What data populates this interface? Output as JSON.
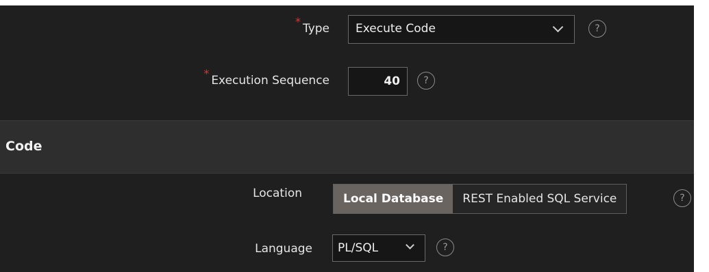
{
  "fields": {
    "type": {
      "label": "Type",
      "required_mark": "*",
      "value": "Execute Code",
      "help": "?"
    },
    "execution_sequence": {
      "label": "Execution Sequence",
      "required_mark": "*",
      "value": "40",
      "help": "?"
    }
  },
  "section": {
    "title": "Code"
  },
  "code": {
    "location": {
      "label": "Location",
      "options": [
        "Local Database",
        "REST Enabled SQL Service"
      ],
      "selected": "Local Database",
      "help": "?"
    },
    "language": {
      "label": "Language",
      "value": "PL/SQL",
      "help": "?"
    }
  },
  "colors": {
    "panel_bg": "#1f1f1f",
    "section_bg": "#2e2e2e",
    "required": "#d9392f",
    "active_segment": "#6a6461"
  }
}
